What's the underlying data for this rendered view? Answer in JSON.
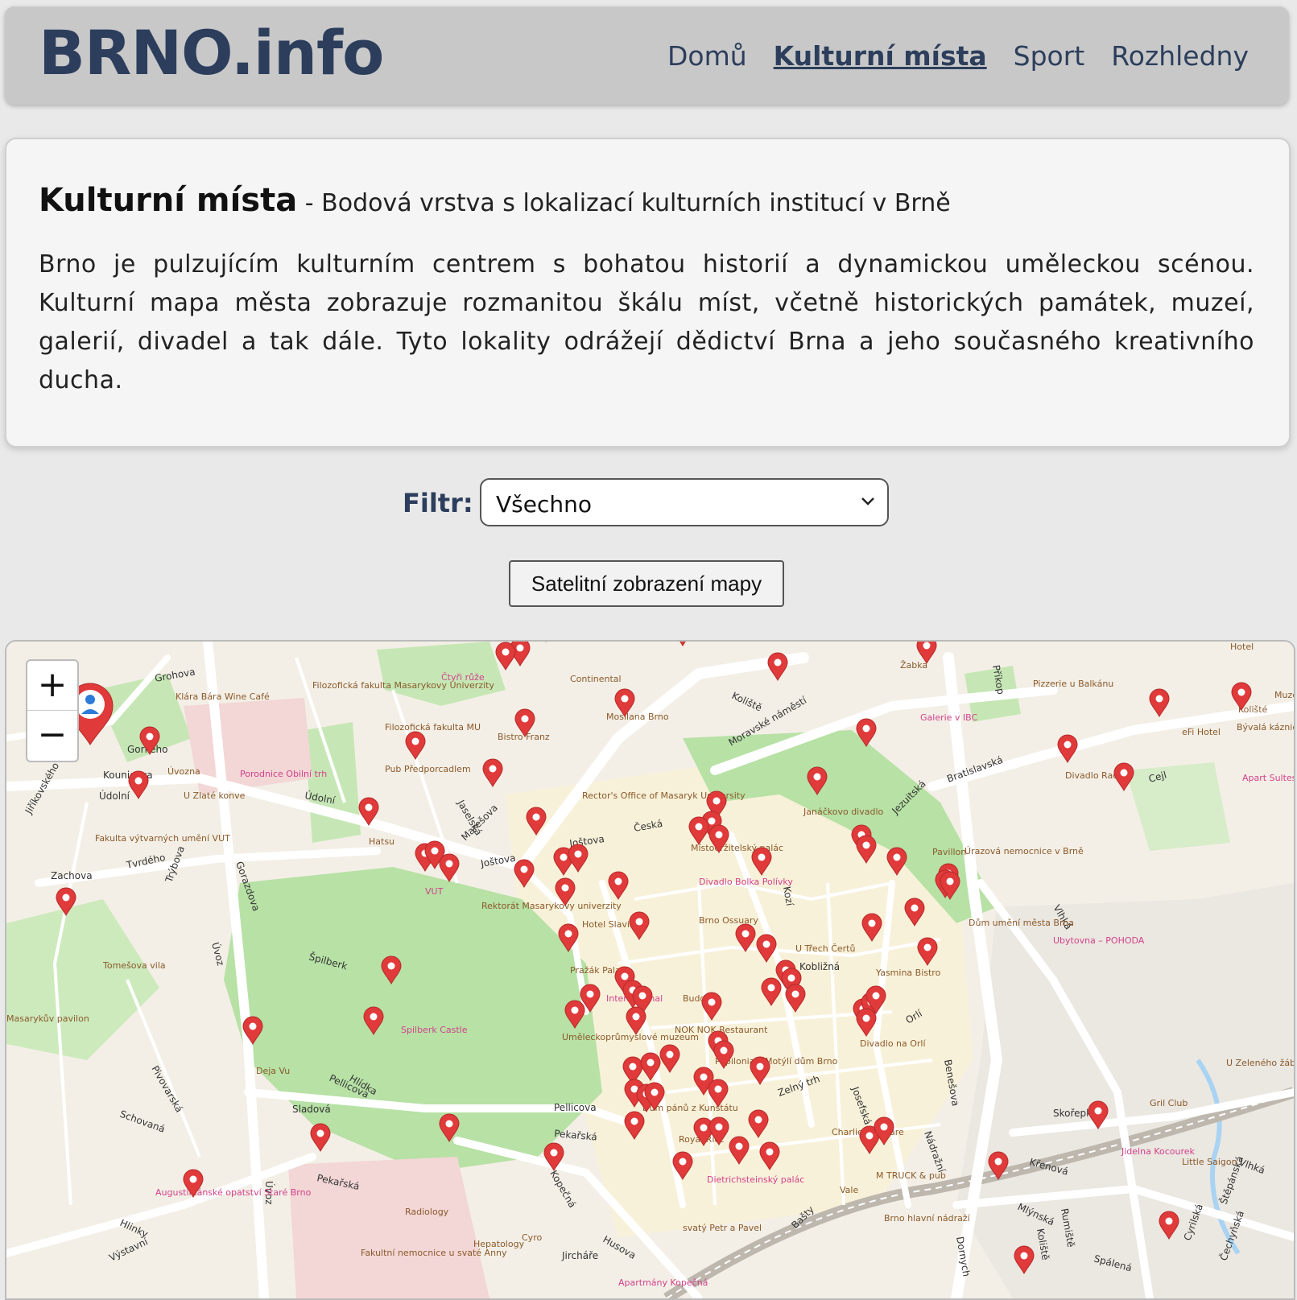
{
  "header": {
    "logo": "BRNO.info",
    "nav": [
      {
        "label": "Domů",
        "active": false
      },
      {
        "label": "Kulturní místa",
        "active": true
      },
      {
        "label": "Sport",
        "active": false
      },
      {
        "label": "Rozhledny",
        "active": false
      }
    ]
  },
  "intro": {
    "title": "Kulturní místa",
    "subtitle": " - Bodová vrstva s lokalizací kulturních institucí v Brně",
    "text": "Brno je pulzujícím kulturním centrem s bohatou historií a dynamickou uměleckou scénou. Kulturní mapa města zobrazuje rozmanitou škálu míst, včetně historických památek, muzeí, galerií, divadel a tak dále. Tyto lokality odrážejí dědictví Brna a jeho současného kreativního ducha."
  },
  "filter": {
    "label": "Filtr:",
    "selected": "Všechno"
  },
  "satellite_button": "Satelitní zobrazení mapy",
  "map": {
    "zoom_in": "+",
    "zoom_out": "−",
    "street_labels": [
      "Grohova",
      "Kounicova",
      "Gorkého",
      "Údolní",
      "Jiříkovského",
      "Zachova",
      "Tvrdého",
      "Trýbova",
      "Údolní",
      "Gorazdova",
      "Úvoz",
      "Jaselská",
      "Marešova",
      "Joštova",
      "Joštova",
      "Česká",
      "Koliště",
      "Moravské náměstí",
      "Bratislavská",
      "Cejl",
      "Jezuitská",
      "Špilberk",
      "Pellicova",
      "Pekařská",
      "Pekařská",
      "Hlinky",
      "Husova",
      "Křenová",
      "Vlhká",
      "Nádražní",
      "Dornych",
      "Koliště",
      "Benešova",
      "Orlí",
      "Josefská",
      "Zelný trh",
      "Sladová",
      "Schovaná",
      "Pivovarská",
      "Hlídka",
      "Výstavní",
      "Kopečná",
      "Jircháře",
      "Bašty",
      "Skořepka",
      "Rumiště",
      "Mlýnská",
      "Spálená",
      "Cyrilská",
      "Štěpánská",
      "Čechyňská",
      "Příkop",
      "Kobližná",
      "Pellicova",
      "Kozí",
      "Vlhká",
      "Úvoz"
    ],
    "poi_labels": [
      "Klára Bára Wine Café",
      "Filozofická fakulta Masarykovy Univerzity",
      "Čtyři růže",
      "Continental",
      "Filozofická fakulta MU",
      "Bistro Franz",
      "Pub Předporcadlem",
      "Porodnice Obilní trh",
      "Úvozna",
      "U Zlaté konve",
      "Fakulta výtvarných umění VUT",
      "Hatsu",
      "VUT",
      "Rektorát Masarykovy univerzity",
      "Rector's Office of Masaryk University",
      "Mosilana Brno",
      "Žabka",
      "Galerie v IBC",
      "Pizzerie u Balkánu",
      "eFi Hotel",
      "Bývalá káznice",
      "Divadlo Radost",
      "Apart Sultes",
      "Úrazová nemocnice v Brně",
      "Pavillon",
      "Janáčkovo divadlo",
      "Místodržitelský palác",
      "Divadlo Bolka Polívky",
      "Brno Ossuary",
      "Hotel Slavia",
      "Pražák Palace",
      "Dům umění města Brna",
      "Ubytovna – POHODA",
      "U Třech Čertů",
      "Yasmina Bistro",
      "Tomešova vila",
      "Masarykův pavilon",
      "Spilberk Castle",
      "Deja Vu",
      "Buddha",
      "NOK NOK Restaurant",
      "Uměleckoprůmyslové muzeum",
      "International",
      "Papilonia – Motýlí dům Brno",
      "Divadlo na Orlí",
      "U Zeleného žáby",
      "Gril Club",
      "Jidelna Kocourek",
      "Little Saigon",
      "Dům pánů z Kunštátu",
      "Royal Ricc",
      "Charlie's Square",
      "Dietrichsteinský palác",
      "M TRUCK & pub",
      "Vale",
      "svatý Petr a Pavel",
      "Brno hlavní nádraží",
      "Augustiniánské opatství Staré Brno",
      "Radiology",
      "Hepatology",
      "Cyro",
      "Fakultní nemocnice u svaté Anny",
      "Apartmány Kopečná",
      "Hotel",
      "Kolišté",
      "Muzeum Romské kultury"
    ],
    "colors": {
      "park": "#b9e3a8",
      "road": "#ffffff",
      "land": "#f3efe6",
      "oldtown": "#f7f0d8",
      "hospital": "#f5d9d9",
      "marker": "#e03a3a",
      "label": "#8a5a2b",
      "water": "#aad3f5"
    }
  }
}
